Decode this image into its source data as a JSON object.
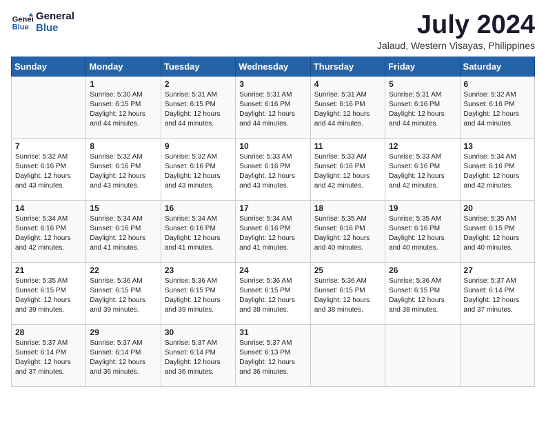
{
  "header": {
    "logo_line1": "General",
    "logo_line2": "Blue",
    "month_year": "July 2024",
    "location": "Jalaud, Western Visayas, Philippines"
  },
  "weekdays": [
    "Sunday",
    "Monday",
    "Tuesday",
    "Wednesday",
    "Thursday",
    "Friday",
    "Saturday"
  ],
  "weeks": [
    [
      {
        "day": "",
        "info": ""
      },
      {
        "day": "1",
        "info": "Sunrise: 5:30 AM\nSunset: 6:15 PM\nDaylight: 12 hours\nand 44 minutes."
      },
      {
        "day": "2",
        "info": "Sunrise: 5:31 AM\nSunset: 6:15 PM\nDaylight: 12 hours\nand 44 minutes."
      },
      {
        "day": "3",
        "info": "Sunrise: 5:31 AM\nSunset: 6:16 PM\nDaylight: 12 hours\nand 44 minutes."
      },
      {
        "day": "4",
        "info": "Sunrise: 5:31 AM\nSunset: 6:16 PM\nDaylight: 12 hours\nand 44 minutes."
      },
      {
        "day": "5",
        "info": "Sunrise: 5:31 AM\nSunset: 6:16 PM\nDaylight: 12 hours\nand 44 minutes."
      },
      {
        "day": "6",
        "info": "Sunrise: 5:32 AM\nSunset: 6:16 PM\nDaylight: 12 hours\nand 44 minutes."
      }
    ],
    [
      {
        "day": "7",
        "info": "Sunrise: 5:32 AM\nSunset: 6:16 PM\nDaylight: 12 hours\nand 43 minutes."
      },
      {
        "day": "8",
        "info": "Sunrise: 5:32 AM\nSunset: 6:16 PM\nDaylight: 12 hours\nand 43 minutes."
      },
      {
        "day": "9",
        "info": "Sunrise: 5:32 AM\nSunset: 6:16 PM\nDaylight: 12 hours\nand 43 minutes."
      },
      {
        "day": "10",
        "info": "Sunrise: 5:33 AM\nSunset: 6:16 PM\nDaylight: 12 hours\nand 43 minutes."
      },
      {
        "day": "11",
        "info": "Sunrise: 5:33 AM\nSunset: 6:16 PM\nDaylight: 12 hours\nand 42 minutes."
      },
      {
        "day": "12",
        "info": "Sunrise: 5:33 AM\nSunset: 6:16 PM\nDaylight: 12 hours\nand 42 minutes."
      },
      {
        "day": "13",
        "info": "Sunrise: 5:34 AM\nSunset: 6:16 PM\nDaylight: 12 hours\nand 42 minutes."
      }
    ],
    [
      {
        "day": "14",
        "info": "Sunrise: 5:34 AM\nSunset: 6:16 PM\nDaylight: 12 hours\nand 42 minutes."
      },
      {
        "day": "15",
        "info": "Sunrise: 5:34 AM\nSunset: 6:16 PM\nDaylight: 12 hours\nand 41 minutes."
      },
      {
        "day": "16",
        "info": "Sunrise: 5:34 AM\nSunset: 6:16 PM\nDaylight: 12 hours\nand 41 minutes."
      },
      {
        "day": "17",
        "info": "Sunrise: 5:34 AM\nSunset: 6:16 PM\nDaylight: 12 hours\nand 41 minutes."
      },
      {
        "day": "18",
        "info": "Sunrise: 5:35 AM\nSunset: 6:16 PM\nDaylight: 12 hours\nand 40 minutes."
      },
      {
        "day": "19",
        "info": "Sunrise: 5:35 AM\nSunset: 6:16 PM\nDaylight: 12 hours\nand 40 minutes."
      },
      {
        "day": "20",
        "info": "Sunrise: 5:35 AM\nSunset: 6:15 PM\nDaylight: 12 hours\nand 40 minutes."
      }
    ],
    [
      {
        "day": "21",
        "info": "Sunrise: 5:35 AM\nSunset: 6:15 PM\nDaylight: 12 hours\nand 39 minutes."
      },
      {
        "day": "22",
        "info": "Sunrise: 5:36 AM\nSunset: 6:15 PM\nDaylight: 12 hours\nand 39 minutes."
      },
      {
        "day": "23",
        "info": "Sunrise: 5:36 AM\nSunset: 6:15 PM\nDaylight: 12 hours\nand 39 minutes."
      },
      {
        "day": "24",
        "info": "Sunrise: 5:36 AM\nSunset: 6:15 PM\nDaylight: 12 hours\nand 38 minutes."
      },
      {
        "day": "25",
        "info": "Sunrise: 5:36 AM\nSunset: 6:15 PM\nDaylight: 12 hours\nand 38 minutes."
      },
      {
        "day": "26",
        "info": "Sunrise: 5:36 AM\nSunset: 6:15 PM\nDaylight: 12 hours\nand 38 minutes."
      },
      {
        "day": "27",
        "info": "Sunrise: 5:37 AM\nSunset: 6:14 PM\nDaylight: 12 hours\nand 37 minutes."
      }
    ],
    [
      {
        "day": "28",
        "info": "Sunrise: 5:37 AM\nSunset: 6:14 PM\nDaylight: 12 hours\nand 37 minutes."
      },
      {
        "day": "29",
        "info": "Sunrise: 5:37 AM\nSunset: 6:14 PM\nDaylight: 12 hours\nand 36 minutes."
      },
      {
        "day": "30",
        "info": "Sunrise: 5:37 AM\nSunset: 6:14 PM\nDaylight: 12 hours\nand 36 minutes."
      },
      {
        "day": "31",
        "info": "Sunrise: 5:37 AM\nSunset: 6:13 PM\nDaylight: 12 hours\nand 36 minutes."
      },
      {
        "day": "",
        "info": ""
      },
      {
        "day": "",
        "info": ""
      },
      {
        "day": "",
        "info": ""
      }
    ]
  ]
}
